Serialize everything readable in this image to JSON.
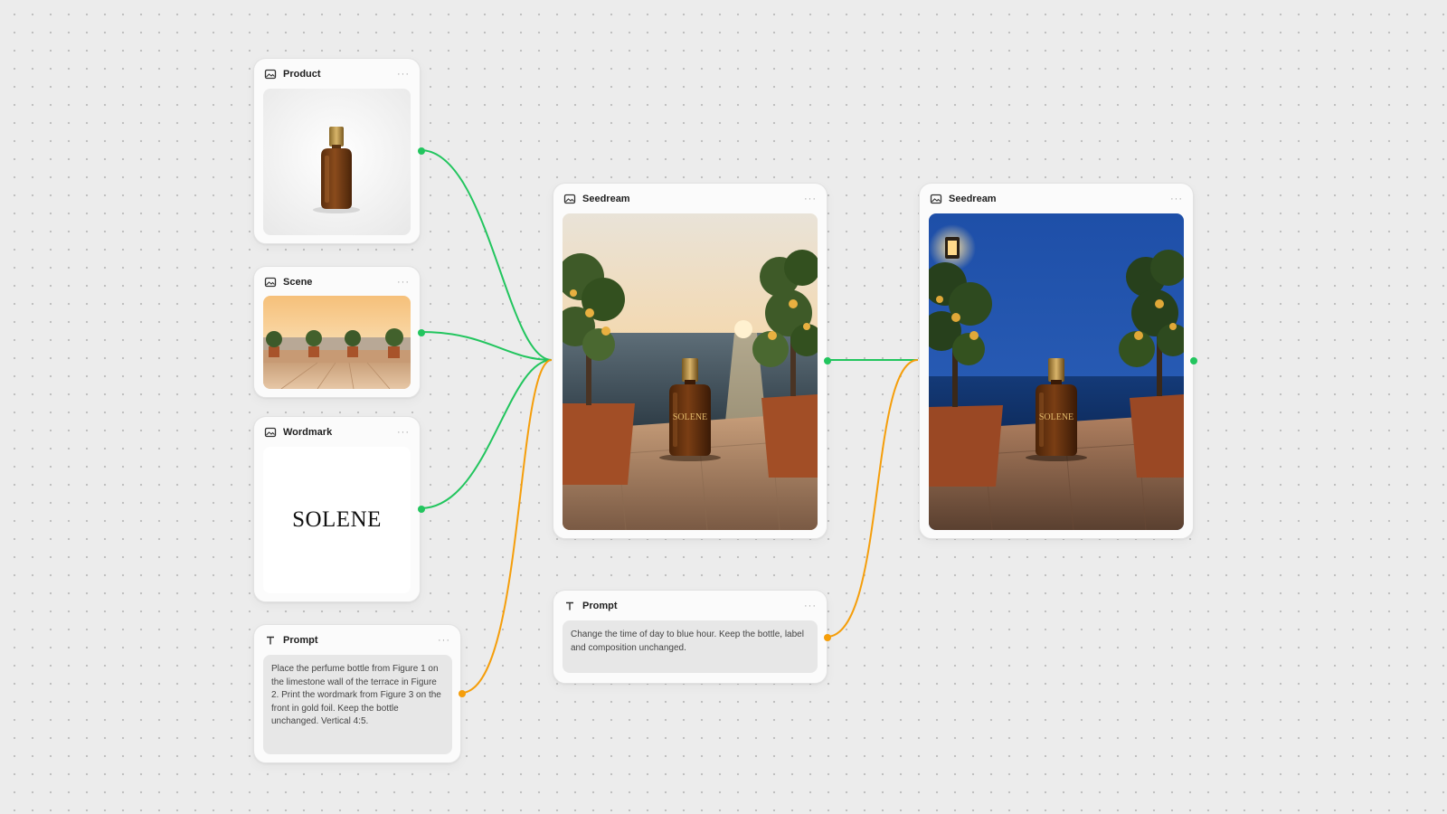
{
  "nodes": {
    "product": {
      "title": "Product"
    },
    "scene": {
      "title": "Scene"
    },
    "wordmark": {
      "title": "Wordmark",
      "text": "SOLENE"
    },
    "prompt1": {
      "title": "Prompt",
      "text": "Place the perfume bottle from Figure 1 on the limestone wall of the terrace in Figure 2. Print the wordmark from Figure 3 on the front in gold foil. Keep the bottle unchanged. Vertical 4:5."
    },
    "seedream1": {
      "title": "Seedream",
      "bottle_label": "SOLENE"
    },
    "prompt2": {
      "title": "Prompt",
      "text": "Change the time of day to blue hour. Keep the bottle, label and composition unchanged."
    },
    "seedream2": {
      "title": "Seedream",
      "bottle_label": "SOLENE"
    }
  },
  "menu_glyph": "···",
  "icons": {
    "image_node": "image-icon",
    "text_node": "text-icon"
  },
  "colors": {
    "canvas": "#ececec",
    "image_edge": "#22c55e",
    "prompt_edge": "#f59e0b"
  }
}
